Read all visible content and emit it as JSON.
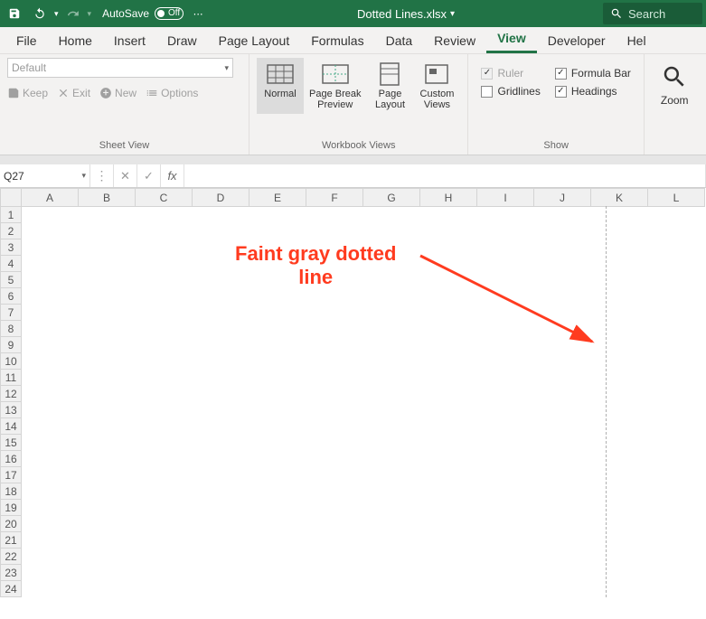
{
  "titlebar": {
    "autosave_label": "AutoSave",
    "autosave_state": "Off",
    "filename": "Dotted Lines.xlsx",
    "search_placeholder": "Search"
  },
  "tabs": [
    "File",
    "Home",
    "Insert",
    "Draw",
    "Page Layout",
    "Formulas",
    "Data",
    "Review",
    "View",
    "Developer",
    "Hel"
  ],
  "active_tab": "View",
  "ribbon": {
    "sheet_view": {
      "dropdown": "Default",
      "keep": "Keep",
      "exit": "Exit",
      "new": "New",
      "options": "Options",
      "group_label": "Sheet View"
    },
    "workbook_views": {
      "items": [
        {
          "label": "Normal",
          "active": true
        },
        {
          "label": "Page Break\nPreview",
          "active": false
        },
        {
          "label": "Page\nLayout",
          "active": false
        },
        {
          "label": "Custom\nViews",
          "active": false
        }
      ],
      "group_label": "Workbook Views"
    },
    "show": {
      "ruler": "Ruler",
      "gridlines": "Gridlines",
      "formula_bar": "Formula Bar",
      "headings": "Headings",
      "group_label": "Show"
    },
    "zoom": {
      "label": "Zoom"
    }
  },
  "namebox": "Q27",
  "columns": [
    "A",
    "B",
    "C",
    "D",
    "E",
    "F",
    "G",
    "H",
    "I",
    "J",
    "K",
    "L"
  ],
  "rows": [
    "1",
    "2",
    "3",
    "4",
    "5",
    "6",
    "7",
    "8",
    "9",
    "10",
    "11",
    "12",
    "13",
    "14",
    "15",
    "16",
    "17",
    "18",
    "19",
    "20",
    "21",
    "22",
    "23",
    "24"
  ],
  "annotation": {
    "text": "Faint gray dotted\nline"
  }
}
